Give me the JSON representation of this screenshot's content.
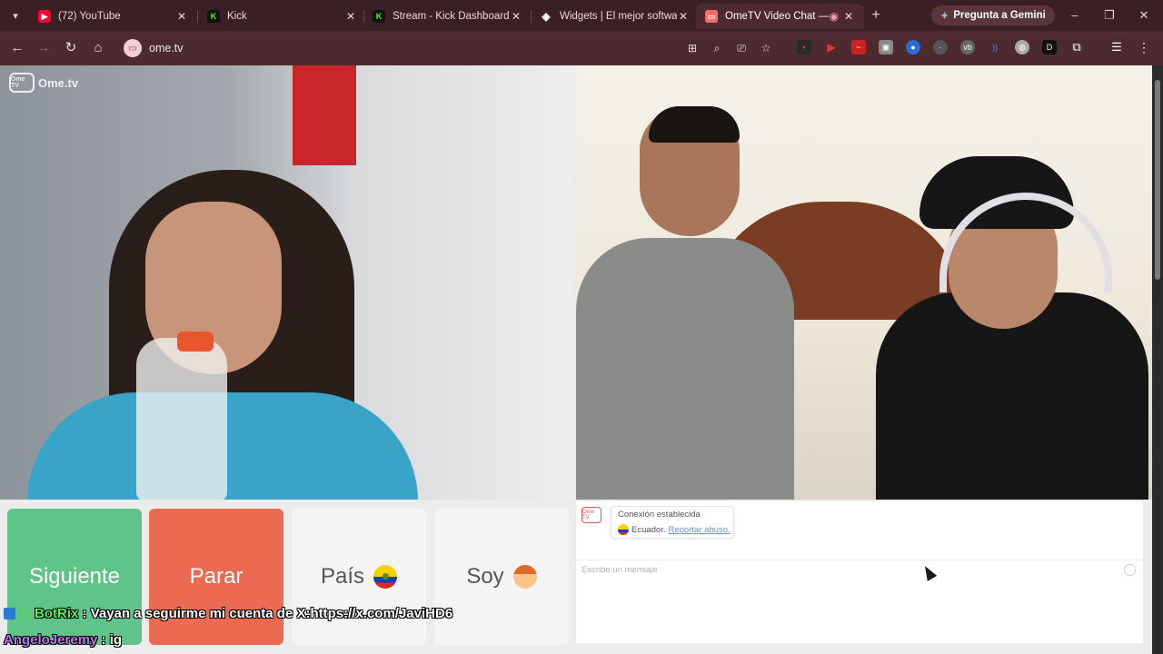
{
  "browser": {
    "tabs": [
      {
        "title": "(72) YouTube",
        "favicon": "youtube-icon",
        "color": "#ff0033"
      },
      {
        "title": "Kick",
        "favicon": "kick-icon",
        "color": "#53fc18"
      },
      {
        "title": "Stream - Kick Dashboard",
        "favicon": "kick-icon",
        "color": "#53fc18"
      },
      {
        "title": "Widgets | El mejor software",
        "favicon": "widgets-icon",
        "color": "#ffffff"
      },
      {
        "title": "OmeTV Video Chat — O",
        "favicon": "ometv-icon",
        "color": "#ff6b6b",
        "active": true
      }
    ],
    "gemini_label": "Pregunta a Gemini",
    "url": "ome.tv",
    "accent": "#4d2a30"
  },
  "page": {
    "watermark": "Ome.tv",
    "watermark_badge": "Ome TV",
    "controls": {
      "next": "Siguiente",
      "stop": "Parar",
      "country": "País",
      "gender": "Soy"
    },
    "chat": {
      "logo": "Ome TV",
      "status": "Conexión establecida",
      "country": "Ecuador.",
      "report": "Reportar abuso.",
      "placeholder": "Escribe un mensaje"
    }
  },
  "stream_overlay": {
    "messages": [
      {
        "user": "BotRix",
        "sep": " : ",
        "text": "Vayan a seguirme mi cuenta de X:https://x.com/JaviHD6"
      },
      {
        "user": "AngeloJeremy",
        "sep": " : ",
        "text": "ig"
      }
    ]
  }
}
